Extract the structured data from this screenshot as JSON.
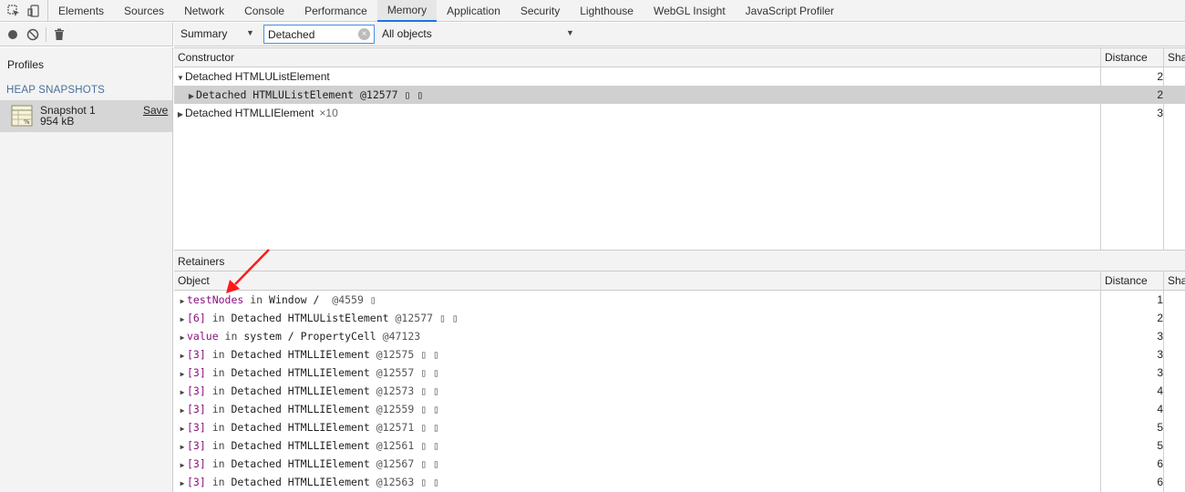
{
  "tabbar": {
    "tabs": [
      {
        "label": "Elements"
      },
      {
        "label": "Sources"
      },
      {
        "label": "Network"
      },
      {
        "label": "Console"
      },
      {
        "label": "Performance"
      },
      {
        "label": "Memory",
        "active": true
      },
      {
        "label": "Application"
      },
      {
        "label": "Security"
      },
      {
        "label": "Lighthouse"
      },
      {
        "label": "WebGL Insight"
      },
      {
        "label": "JavaScript Profiler"
      }
    ]
  },
  "sidebar": {
    "profiles_label": "Profiles",
    "heading": "HEAP SNAPSHOTS",
    "snapshot": {
      "name": "Snapshot 1",
      "size": "954 kB",
      "save_label": "Save"
    }
  },
  "toolbar": {
    "view": "Summary",
    "filter_value": "Detached",
    "class_filter": "All objects"
  },
  "summary": {
    "headers": {
      "constructor": "Constructor",
      "distance": "Distance",
      "shallow": "Sha"
    },
    "rows": [
      {
        "name": "Detached HTMLUListElement",
        "count": "",
        "distance": "2",
        "expanded": true
      },
      {
        "name": "Detached HTMLUListElement @12577 ▯ ▯",
        "count": "",
        "distance": "2",
        "selected": true,
        "child": true
      },
      {
        "name": "Detached HTMLLIElement",
        "count": "×10",
        "distance": "3"
      }
    ]
  },
  "retainers": {
    "title": "Retainers",
    "headers": {
      "object": "Object",
      "distance": "Distance",
      "shallow": "Sha"
    },
    "rows": [
      {
        "prop": "testNodes",
        "in": " in ",
        "obj": "Window /  ",
        "id": "@4559 ▯",
        "distance": "1"
      },
      {
        "prop": "[6]",
        "in": " in ",
        "obj": "Detached HTMLUListElement ",
        "id": "@12577 ▯ ▯",
        "distance": "2"
      },
      {
        "prop": "value",
        "in": " in ",
        "obj": "system / PropertyCell ",
        "id": "@47123",
        "distance": "3"
      },
      {
        "prop": "[3]",
        "in": " in ",
        "obj": "Detached HTMLLIElement ",
        "id": "@12575 ▯ ▯",
        "distance": "3"
      },
      {
        "prop": "[3]",
        "in": " in ",
        "obj": "Detached HTMLLIElement ",
        "id": "@12557 ▯ ▯",
        "distance": "3"
      },
      {
        "prop": "[3]",
        "in": " in ",
        "obj": "Detached HTMLLIElement ",
        "id": "@12573 ▯ ▯",
        "distance": "4"
      },
      {
        "prop": "[3]",
        "in": " in ",
        "obj": "Detached HTMLLIElement ",
        "id": "@12559 ▯ ▯",
        "distance": "4"
      },
      {
        "prop": "[3]",
        "in": " in ",
        "obj": "Detached HTMLLIElement ",
        "id": "@12571 ▯ ▯",
        "distance": "5"
      },
      {
        "prop": "[3]",
        "in": " in ",
        "obj": "Detached HTMLLIElement ",
        "id": "@12561 ▯ ▯",
        "distance": "5"
      },
      {
        "prop": "[3]",
        "in": " in ",
        "obj": "Detached HTMLLIElement ",
        "id": "@12567 ▯ ▯",
        "distance": "6"
      },
      {
        "prop": "[3]",
        "in": " in ",
        "obj": "Detached HTMLLIElement ",
        "id": "@12563 ▯ ▯",
        "distance": "6"
      }
    ]
  },
  "annotation": {
    "color": "#ff1a1a"
  }
}
